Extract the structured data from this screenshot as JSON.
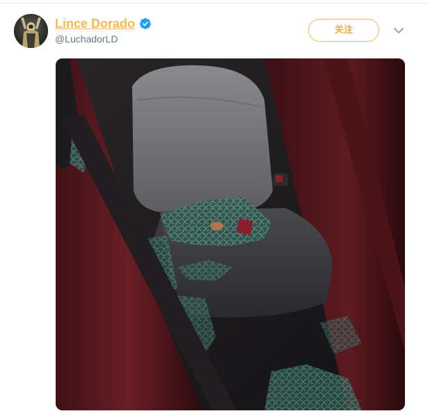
{
  "tweet": {
    "author": {
      "display_name": "Lince Dorado",
      "handle": "@LuchadorLD",
      "verified_icon": "verified-badge-icon",
      "avatar_icon": "user-avatar"
    },
    "follow_button_label": "关注",
    "more_menu_icon": "chevron-down-icon",
    "media": {
      "type": "photo",
      "icon": "photo-broken-car-window"
    }
  },
  "colors": {
    "name_accent": "#f5b94e",
    "follow_border": "#f5b94e",
    "verified_blue": "#1da1f2",
    "handle_gray": "#657786",
    "caret_gray": "#8899a6"
  }
}
